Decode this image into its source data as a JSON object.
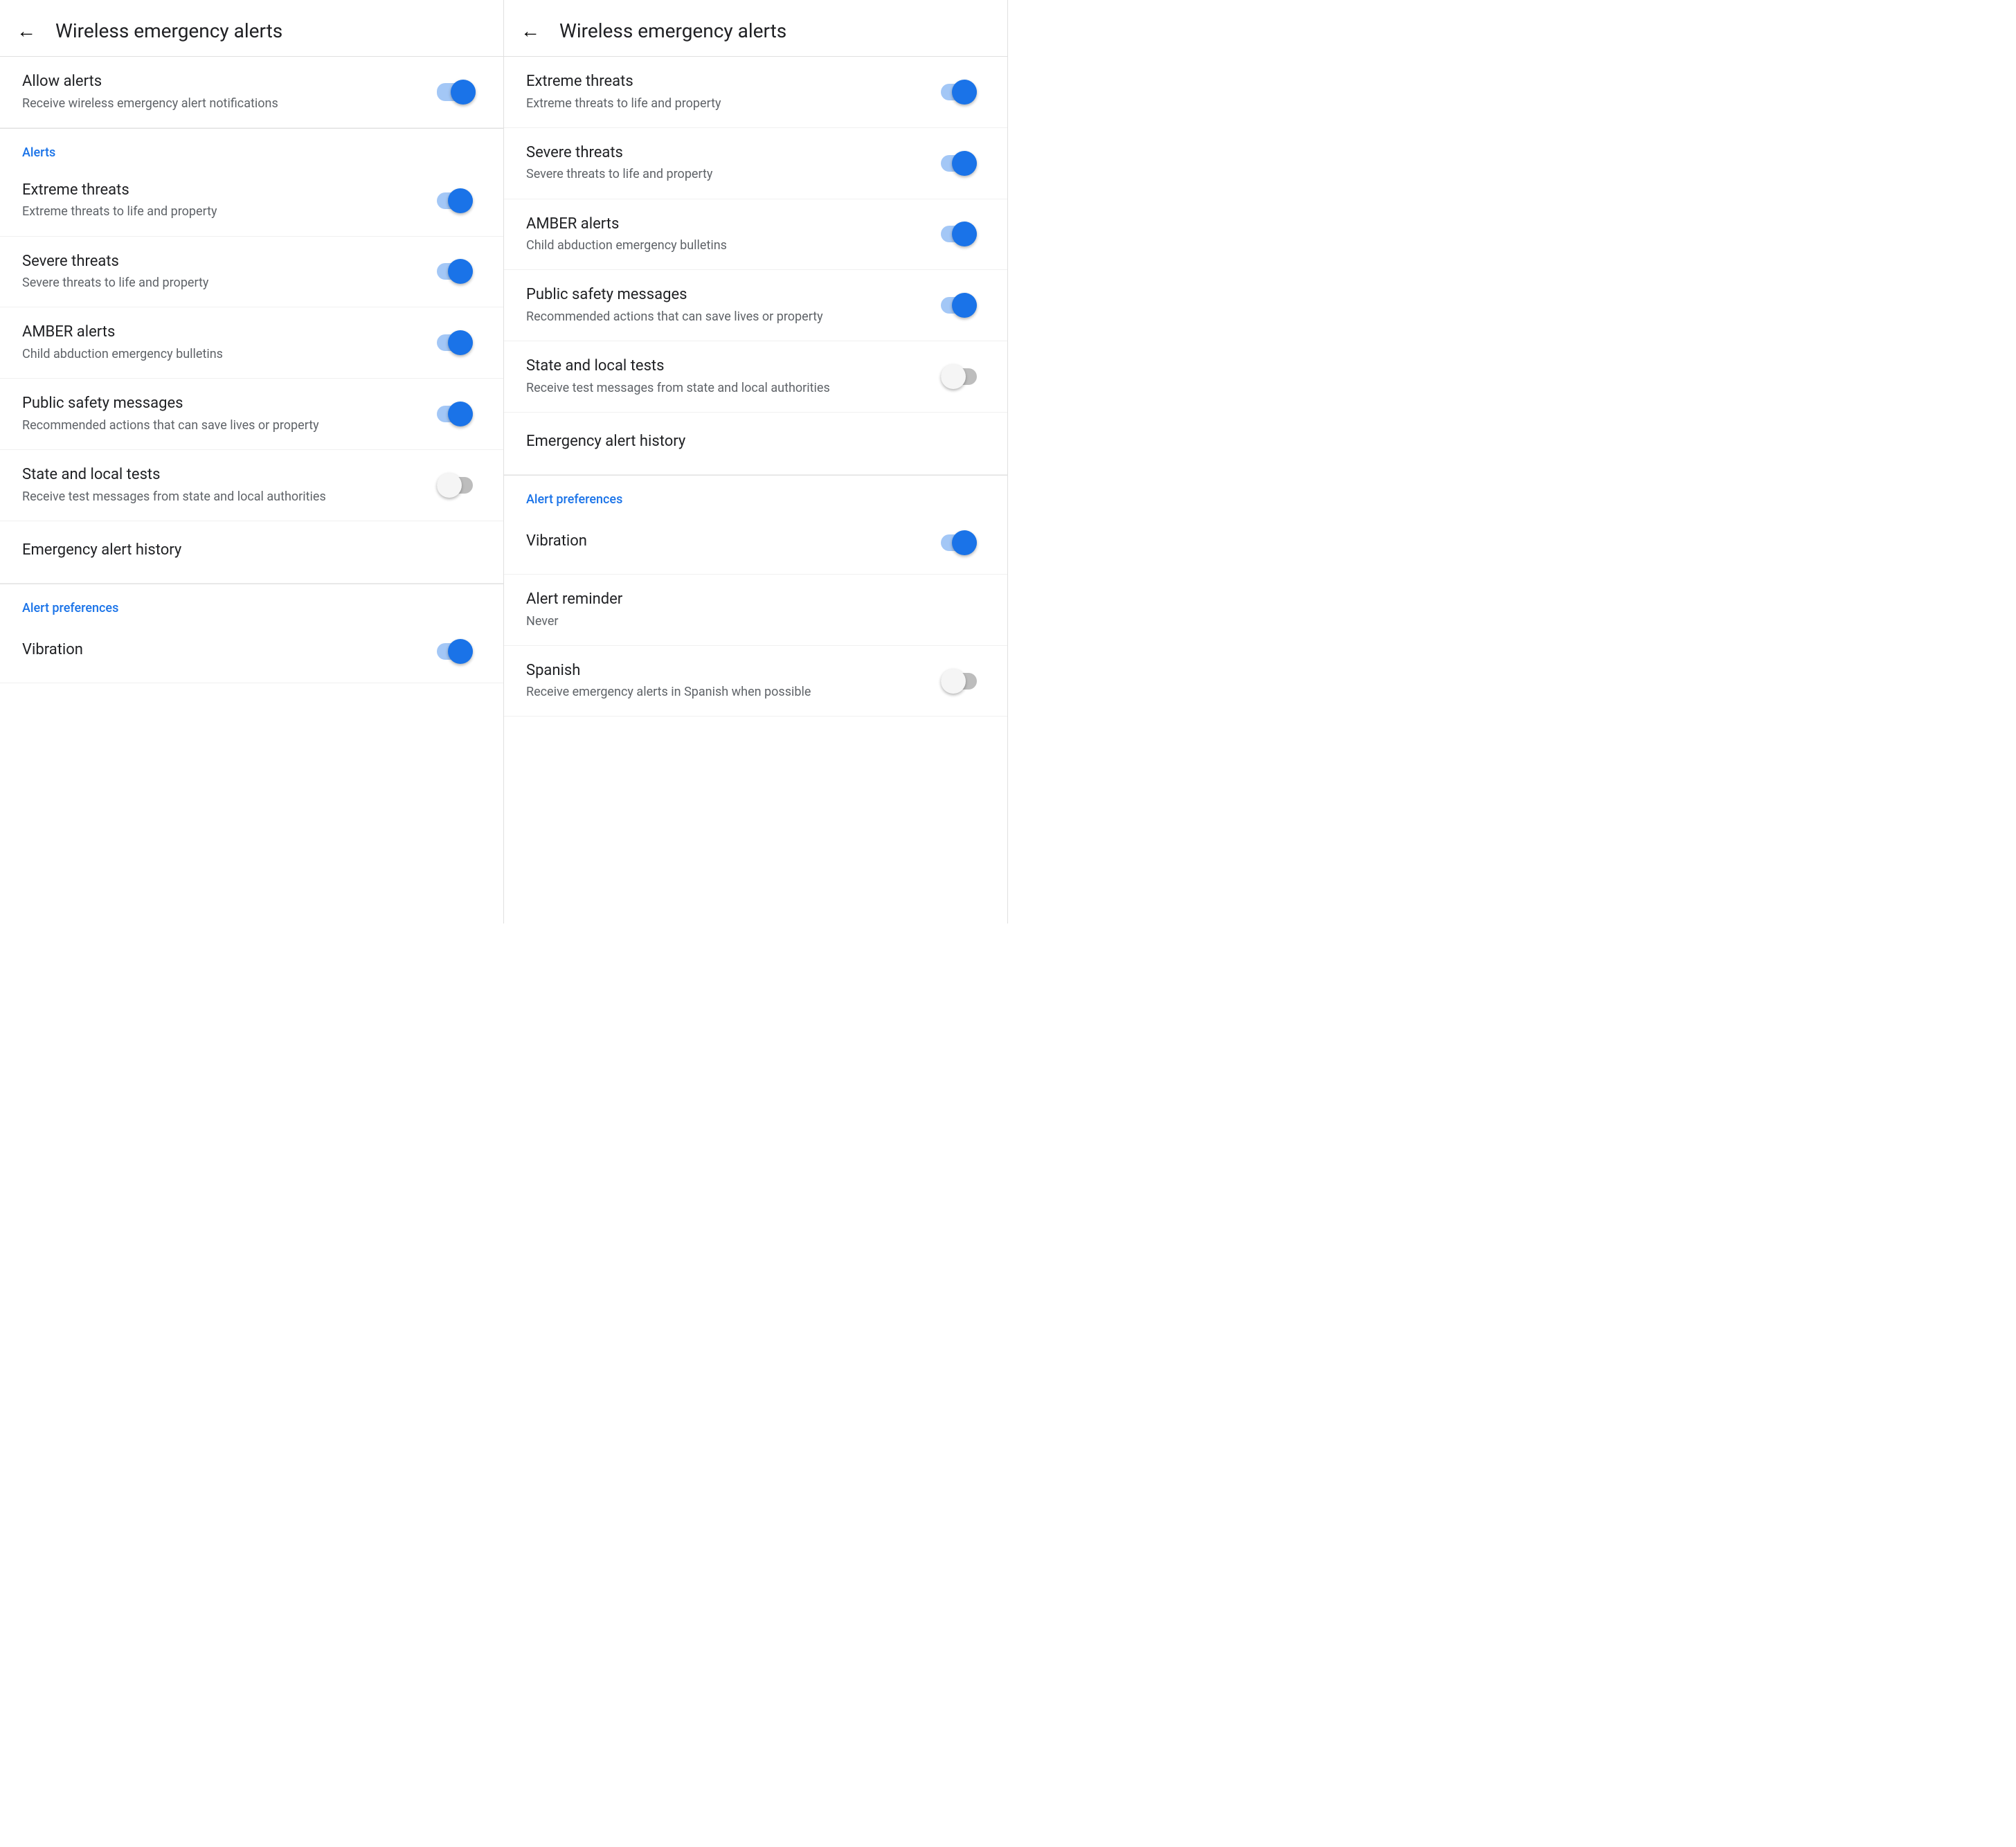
{
  "panels": [
    {
      "id": "left",
      "header": {
        "back_label": "←",
        "title": "Wireless emergency alerts"
      },
      "sections": [
        {
          "type": "settings",
          "items": [
            {
              "id": "allow-alerts",
              "title": "Allow alerts",
              "subtitle": "Receive wireless emergency alert notifications",
              "toggle": true,
              "toggle_on": true,
              "has_divider": true
            }
          ]
        },
        {
          "type": "labeled",
          "label": "Alerts",
          "items": [
            {
              "id": "extreme-threats",
              "title": "Extreme threats",
              "subtitle": "Extreme threats to life and property",
              "toggle": true,
              "toggle_on": true
            },
            {
              "id": "severe-threats",
              "title": "Severe threats",
              "subtitle": "Severe threats to life and property",
              "toggle": true,
              "toggle_on": true
            },
            {
              "id": "amber-alerts",
              "title": "AMBER alerts",
              "subtitle": "Child abduction emergency bulletins",
              "toggle": true,
              "toggle_on": true
            },
            {
              "id": "public-safety",
              "title": "Public safety messages",
              "subtitle": "Recommended actions that can save lives or property",
              "toggle": true,
              "toggle_on": true
            },
            {
              "id": "state-local-tests",
              "title": "State and local tests",
              "subtitle": "Receive test messages from state and local authorities",
              "toggle": true,
              "toggle_on": false
            },
            {
              "id": "emergency-history",
              "title": "Emergency alert history",
              "subtitle": null,
              "toggle": false,
              "has_bottom_divider": true
            }
          ]
        },
        {
          "type": "labeled",
          "label": "Alert preferences",
          "items": [
            {
              "id": "vibration",
              "title": "Vibration",
              "subtitle": null,
              "toggle": true,
              "toggle_on": true
            }
          ]
        }
      ]
    },
    {
      "id": "right",
      "header": {
        "back_label": "←",
        "title": "Wireless emergency alerts"
      },
      "sections": [
        {
          "type": "settings",
          "items": [
            {
              "id": "extreme-threats-r",
              "title": "Extreme threats",
              "subtitle": "Extreme threats to life and property",
              "toggle": true,
              "toggle_on": true
            },
            {
              "id": "severe-threats-r",
              "title": "Severe threats",
              "subtitle": "Severe threats to life and property",
              "toggle": true,
              "toggle_on": true
            },
            {
              "id": "amber-alerts-r",
              "title": "AMBER alerts",
              "subtitle": "Child abduction emergency bulletins",
              "toggle": true,
              "toggle_on": true
            },
            {
              "id": "public-safety-r",
              "title": "Public safety messages",
              "subtitle": "Recommended actions that can save lives or property",
              "toggle": true,
              "toggle_on": true
            },
            {
              "id": "state-local-r",
              "title": "State and local tests",
              "subtitle": "Receive test messages from state and local authorities",
              "toggle": true,
              "toggle_on": false
            },
            {
              "id": "emergency-history-r",
              "title": "Emergency alert history",
              "subtitle": null,
              "toggle": false,
              "has_bottom_divider": true
            }
          ]
        },
        {
          "type": "labeled",
          "label": "Alert preferences",
          "items": [
            {
              "id": "vibration-r",
              "title": "Vibration",
              "subtitle": null,
              "toggle": true,
              "toggle_on": true
            },
            {
              "id": "alert-reminder-r",
              "title": "Alert reminder",
              "subtitle": "Never",
              "toggle": false,
              "clickable": true
            },
            {
              "id": "spanish-r",
              "title": "Spanish",
              "subtitle": "Receive emergency alerts in Spanish when possible",
              "toggle": true,
              "toggle_on": false
            }
          ]
        }
      ]
    }
  ]
}
